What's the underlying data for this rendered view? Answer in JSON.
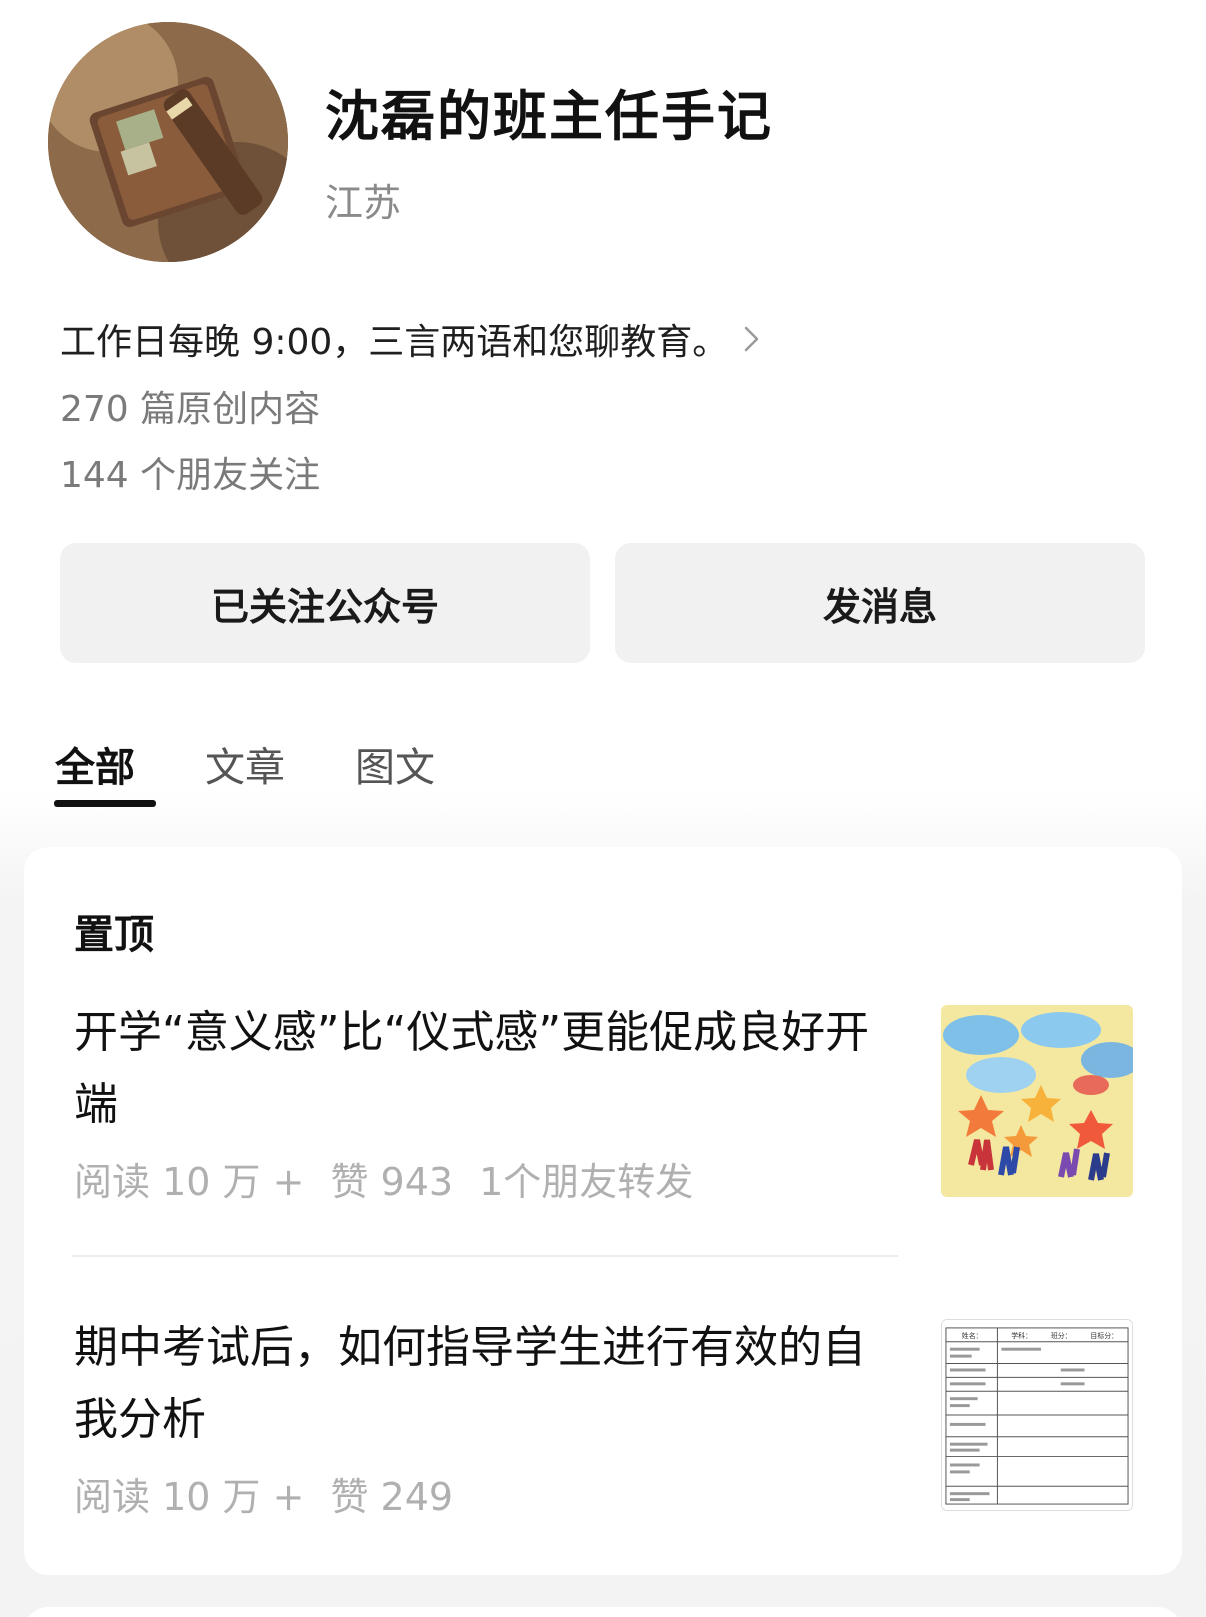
{
  "profile": {
    "name": "沈磊的班主任手记",
    "region": "江苏",
    "intro": "工作日每晚 9:00，三言两语和您聊教育。",
    "original_count": "270 篇原创内容",
    "friends_following": "144 个朋友关注"
  },
  "actions": {
    "follow_label": "已关注公众号",
    "message_label": "发消息"
  },
  "tabs": [
    {
      "label": "全部",
      "active": true
    },
    {
      "label": "文章",
      "active": false
    },
    {
      "label": "图文",
      "active": false
    }
  ],
  "feed": {
    "pinned_label": "置顶",
    "articles": [
      {
        "title": "开学“意义感”比“仪式感”更能促成良好开端",
        "reads": "阅读 10 万 +",
        "likes": "赞 943",
        "shares": "1个朋友转发"
      },
      {
        "title": "期中考试后，如何指导学生进行有效的自我分析",
        "reads": "阅读 10 万 +",
        "likes": "赞 249"
      }
    ]
  },
  "thumb2_texts": {
    "h1": "姓名：",
    "h2": "学科：",
    "h3": "班分：",
    "h4": "目标分："
  }
}
